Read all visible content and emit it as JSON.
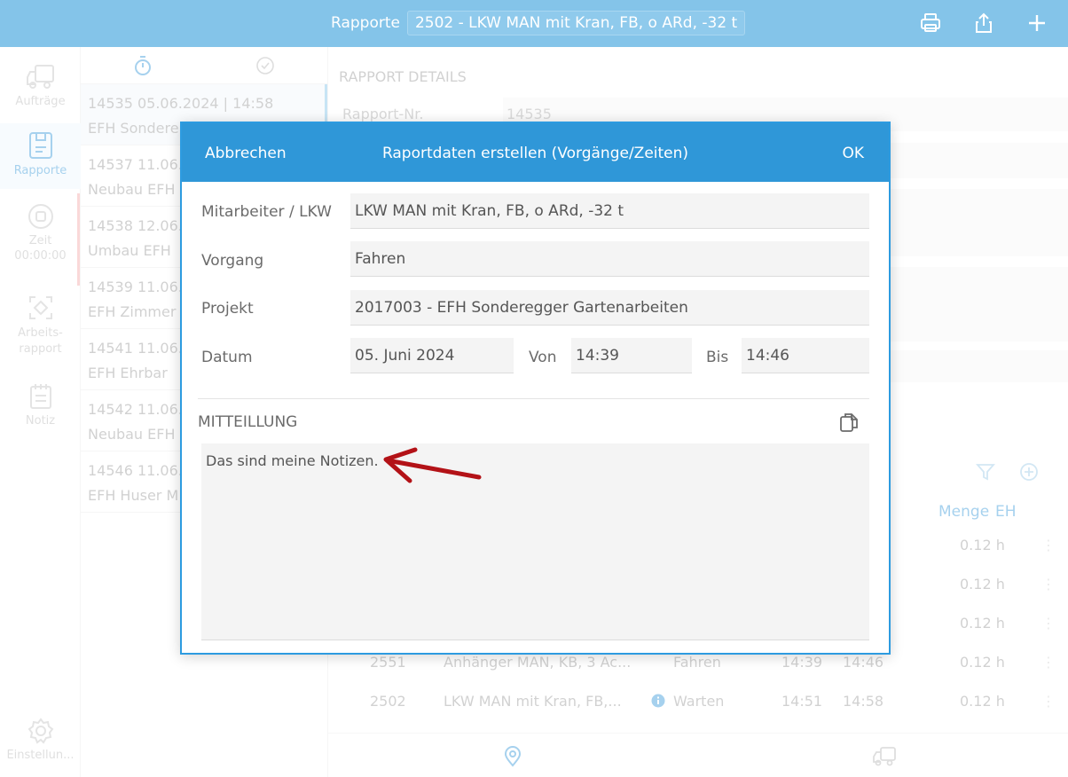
{
  "topbar": {
    "title": "Rapporte",
    "selector": "2502 - LKW MAN mit Kran, FB, o ARd, -32 t",
    "icons": [
      "printer-icon",
      "share-icon",
      "plus-icon"
    ]
  },
  "nav": {
    "items": [
      {
        "label": "Aufträge",
        "icon": "truck-icon"
      },
      {
        "label": "Rapporte",
        "icon": "clipboard-icon"
      },
      {
        "label": "Zeit",
        "sub": "00:00:00",
        "icon": "record-icon"
      },
      {
        "label": "Arbeits-rapport",
        "icon": "scan-icon"
      },
      {
        "label": "Notiz",
        "icon": "note-icon"
      }
    ],
    "settings_label": "Einstellun..."
  },
  "list": {
    "header_icons": [
      "stopwatch-icon",
      "check-circle-icon"
    ],
    "items": [
      {
        "line1": "14535  05.06.2024 | 14:58",
        "line2": "EFH Sondere"
      },
      {
        "line1": "14537  11.06.",
        "line2": "Neubau EFH"
      },
      {
        "line1": "14538  12.06.",
        "line2": "Umbau EFH"
      },
      {
        "line1": "14539  11.06.",
        "line2": "EFH Zimmer"
      },
      {
        "line1": "14541  11.06.2",
        "line2": "EFH Ehrbar"
      },
      {
        "line1": "14542  11.06.",
        "line2": "Neubau EFH"
      },
      {
        "line1": "14546  11.06.",
        "line2": "EFH Huser M"
      }
    ]
  },
  "detail": {
    "heading": "RAPPORT DETAILS",
    "rapport_nr_label": "Rapport-Nr.",
    "rapport_nr_value": "14535",
    "table_header_menge": "Menge",
    "table_header_eh": "EH",
    "rows": [
      {
        "menge": "0.12 h"
      },
      {
        "menge": "0.12 h"
      },
      {
        "menge": "0.12 h"
      },
      {
        "nr": "2551",
        "name": "Anhänger MAN, KB, 3 Ac...",
        "vorgang": "Fahren",
        "von": "14:39",
        "bis": "14:46",
        "menge": "0.12 h"
      },
      {
        "nr": "2502",
        "name": "LKW MAN mit Kran, FB,...",
        "vorgang": "Warten",
        "von": "14:51",
        "bis": "14:58",
        "menge": "0.12 h"
      }
    ]
  },
  "modal": {
    "cancel": "Abbrechen",
    "title": "Raportdaten erstellen (Vorgänge/Zeiten)",
    "ok": "OK",
    "fields": {
      "mitarbeiter_label": "Mitarbeiter / LKW",
      "mitarbeiter_value": "LKW MAN mit Kran, FB, o ARd, -32 t",
      "vorgang_label": "Vorgang",
      "vorgang_value": "Fahren",
      "projekt_label": "Projekt",
      "projekt_value": "2017003 - EFH Sonderegger Gartenarbeiten",
      "datum_label": "Datum",
      "datum_value": "05. Juni 2024",
      "von_label": "Von",
      "von_value": "14:39",
      "bis_label": "Bis",
      "bis_value": "14:46"
    },
    "mitteilung_label": "MITTEILLUNG",
    "notes": "Das sind meine Notizen."
  },
  "colors": {
    "topbar": "#84c4e9",
    "accent": "#2f97d8",
    "arrow": "#b31217"
  }
}
